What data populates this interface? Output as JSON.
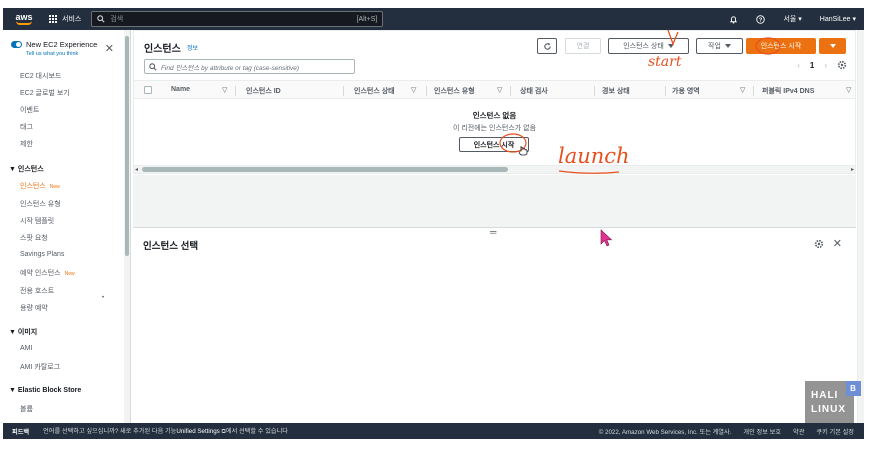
{
  "topnav": {
    "logo": "aws",
    "services_label": "서비스",
    "search_placeholder": "검색",
    "search_shortcut": "[Alt+S]",
    "region": "서울 ▾",
    "user": "HanSiLee ▾"
  },
  "sidebar": {
    "title": "New EC2 Experience",
    "subtitle": "Tell us what you think",
    "items": [
      {
        "label": "EC2 대시보드"
      },
      {
        "label": "EC2 글로벌 보기"
      },
      {
        "label": "이벤트"
      },
      {
        "label": "태그"
      },
      {
        "label": "제한"
      }
    ],
    "group_instances": "▼ 인스턴스",
    "instances_items": [
      {
        "label": "인스턴스",
        "badge": "New"
      },
      {
        "label": "인스턴스 유형"
      },
      {
        "label": "시작 템플릿"
      },
      {
        "label": "스팟 요청"
      },
      {
        "label": "Savings Plans"
      },
      {
        "label": "예약 인스턴스",
        "badge": "New"
      },
      {
        "label": "전용 호스트"
      },
      {
        "label": "용량 예약"
      }
    ],
    "group_images": "▼ 이미지",
    "images_items": [
      {
        "label": "AMI"
      },
      {
        "label": "AMI 카탈로그"
      }
    ],
    "group_ebs": "▼ Elastic Block Store",
    "ebs_items": [
      {
        "label": "볼륨"
      }
    ]
  },
  "main": {
    "title": "인스턴스",
    "info": "정보",
    "connect_label": "연결",
    "state_label": "인스턴스 상태",
    "actions_label": "작업",
    "launch_label": "인스턴스 시작",
    "filter_placeholder": "Find 인스턴스 by attribute or tag (case-sensitive)",
    "page_number": "1",
    "columns": [
      "Name",
      "인스턴스 ID",
      "인스턴스 상태",
      "인스턴스 유형",
      "상태 검사",
      "경보 상태",
      "가용 영역",
      "퍼블릭 IPv4 DNS"
    ],
    "empty_title": "인스턴스 없음",
    "empty_desc": "이 리전에는 인스턴스가 없음",
    "empty_launch": "인스턴스 시작",
    "split_title": "인스턴스 선택"
  },
  "footer": {
    "feedback": "피드백",
    "message_pre": "언어를 선택하고 싶으십니까? 새로 추가된 다음 기능",
    "message_link": "Unified Settings",
    "message_post": "에서 선택할 수 있습니다",
    "copyright": "© 2022, Amazon Web Services, Inc. 또는 계열사.",
    "privacy": "개인 정보 보호",
    "terms": "약관",
    "cookies": "쿠키 기본 설정"
  },
  "annotations": {
    "start": "start",
    "launch": "launch"
  },
  "watermark": {
    "line1": "HALI",
    "line2": "LINUX",
    "badge": "B"
  },
  "colors": {
    "nav_bg": "#232f3e",
    "accent": "#ec7211",
    "link": "#0073bb",
    "annotation": "#e8501e"
  }
}
